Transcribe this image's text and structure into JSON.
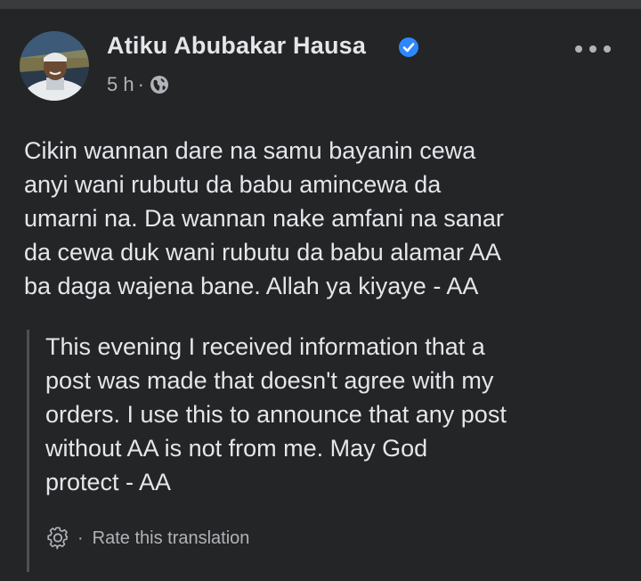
{
  "post": {
    "author": "Atiku Abubakar Hausa",
    "verified": true,
    "timestamp": "5 h",
    "separator": "·",
    "audience_icon": "globe-icon",
    "more_icon": "more-options-icon",
    "text": "Cikin wannan dare na samu bayanin cewa\nanyi wani rubutu da babu amincewa da\numarni na. Da wannan nake amfani na sanar\nda cewa duk wani rubutu da babu alamar AA\nba daga wajena bane. Allah ya kiyaye - AA",
    "translation": {
      "text": "This evening I received information that a\npost was made that doesn't agree with my\norders. I use this to announce that any post\nwithout AA is not from me. May God\nprotect - AA",
      "settings_icon": "gear-icon",
      "separator": "·",
      "rate_label": "Rate this translation"
    }
  },
  "colors": {
    "background": "#242526",
    "text_primary": "#e4e6eb",
    "text_secondary": "#b0b3b8",
    "verified_badge": "#2d88ff",
    "quote_border": "#4e4f50"
  }
}
